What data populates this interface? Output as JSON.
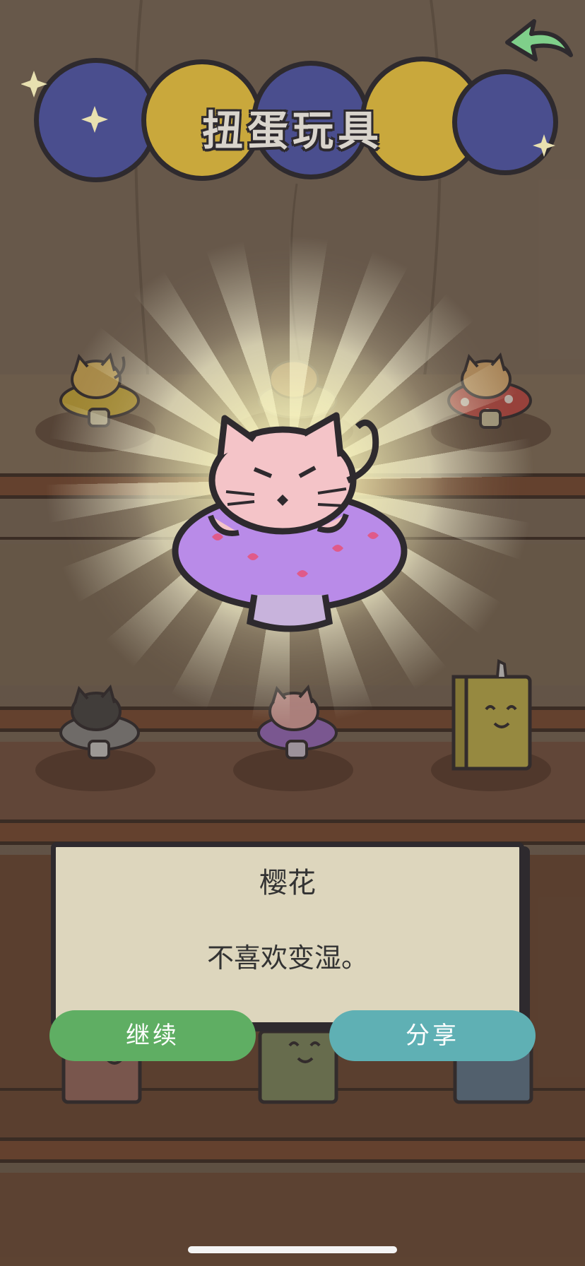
{
  "header": {
    "title": "扭蛋玩具",
    "back_icon": "back-arrow-icon"
  },
  "dialog": {
    "name": "樱花",
    "description": "不喜欢变湿。"
  },
  "buttons": {
    "continue_label": "继续",
    "share_label": "分享"
  },
  "colors": {
    "continue": "#5fae63",
    "share": "#5fb0b4",
    "capsule_blue": "#4a4e8e",
    "capsule_gold": "#c9a83c",
    "hero_cat": "#f4c4c8",
    "hero_mushroom": "#b98be8"
  }
}
